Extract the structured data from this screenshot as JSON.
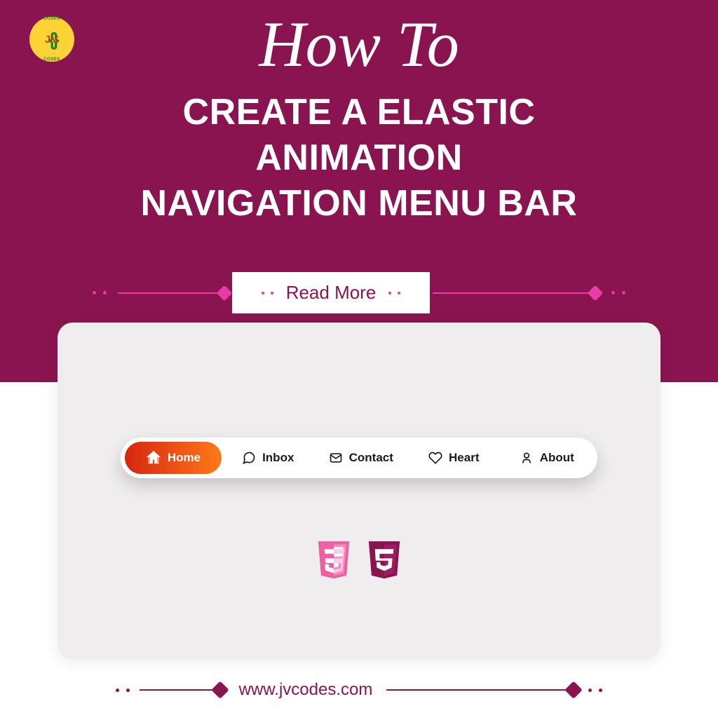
{
  "logo": {
    "initials": "JV",
    "caption": "CODES"
  },
  "header": {
    "script_title": "How To",
    "heading_line1": "CREATE A ELASTIC",
    "heading_line2": "ANIMATION",
    "heading_line3": "NAVIGATION MENU BAR",
    "cta_label": "Read More"
  },
  "nav": {
    "items": [
      {
        "label": "Home",
        "icon": "home-icon",
        "active": true
      },
      {
        "label": "Inbox",
        "icon": "chat-icon",
        "active": false
      },
      {
        "label": "Contact",
        "icon": "mail-icon",
        "active": false
      },
      {
        "label": "Heart",
        "icon": "heart-icon",
        "active": false
      },
      {
        "label": "About",
        "icon": "user-icon",
        "active": false
      }
    ]
  },
  "tech": {
    "icons": [
      "html5-icon",
      "css3-icon"
    ]
  },
  "footer": {
    "url": "www.jvcodes.com"
  },
  "colors": {
    "primary": "#8a1450",
    "accent": "#e83ba8",
    "nav_active_start": "#d62410",
    "nav_active_end": "#ff7a18"
  }
}
